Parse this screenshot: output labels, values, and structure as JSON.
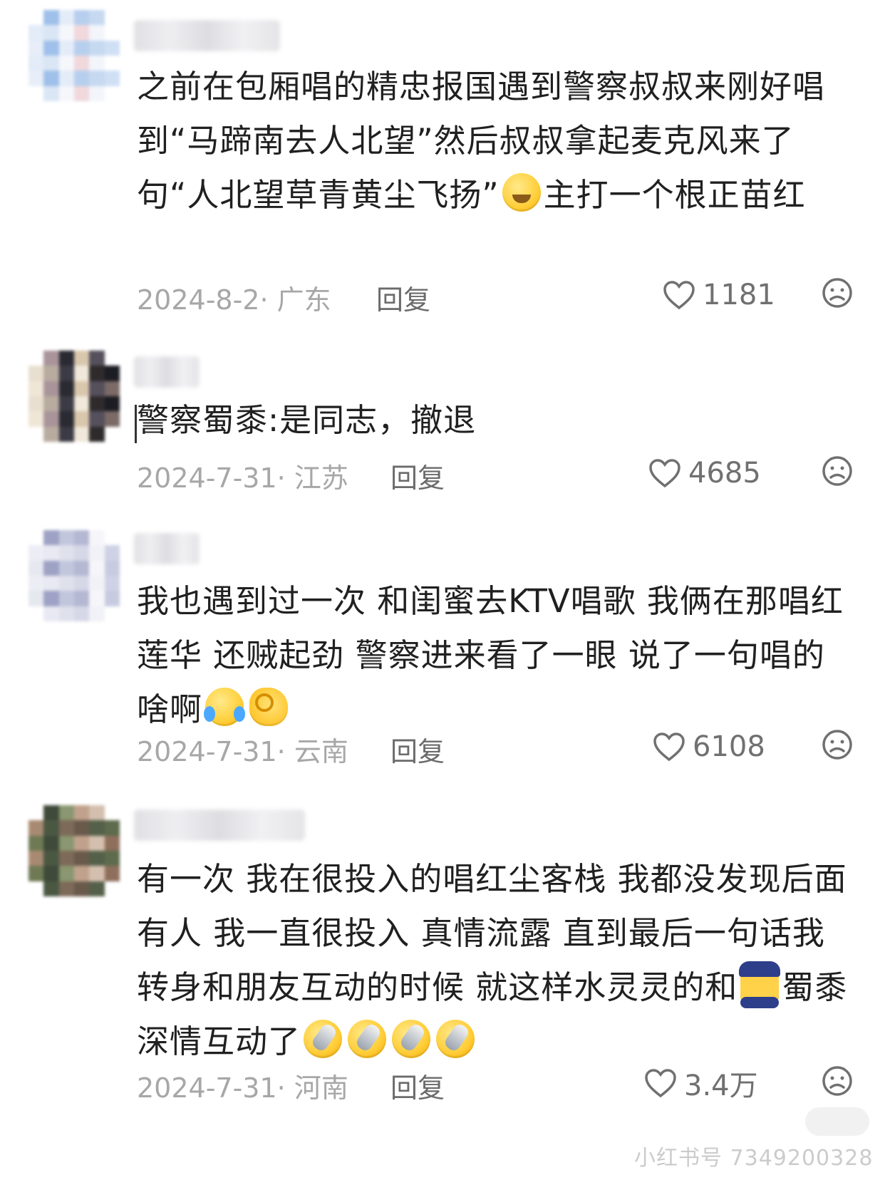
{
  "comments": [
    {
      "avatar_colors": [
        "#e8eef8",
        "#cfe0f5",
        "#f3f5fb",
        "#b7cfee",
        "#f6f7fb",
        "#9fc0ea",
        "#e2ebf7",
        "#ffffff",
        "#c6d9f1",
        "#f0d8dd",
        "#e4ecf8",
        "#dbe6f5"
      ],
      "text_before_emoji": "之前在包厢唱的精忠报国遇到警察叔叔来刚好唱到“马蹄南去人北望”然后叔叔拿起麦克风来了句“人北望草青黄尘飞扬”",
      "emoji": "pleading-face-icon",
      "text_after_emoji": "主打一个根正苗红",
      "date": "2024-8-2· 广东",
      "reply_label": "回复",
      "likes": "1181"
    },
    {
      "avatar_colors": [
        "#efe6d6",
        "#7b6a66",
        "#2f2a2c",
        "#d9c7ad",
        "#3c3a44",
        "#a9949a",
        "#e8dfd0",
        "#1c1c24",
        "#55505c",
        "#f0e8da",
        "#2a2a32",
        "#b8aca0"
      ],
      "text": "警察蜀黍:是同志，撤退",
      "date": "2024-7-31· 江苏",
      "reply_label": "回复",
      "likes": "4685"
    },
    {
      "avatar_colors": [
        "#e6e8f0",
        "#c8cbe0",
        "#f1f2f7",
        "#b5b8d2",
        "#dfe1ec",
        "#9ea2c4",
        "#eceef5",
        "#cfd2e6",
        "#f6f6fa",
        "#d6d8e8",
        "#c2c6dd",
        "#e8e9f2"
      ],
      "text_before_emoji": "我也遇到过一次 和闺蜜去KTV唱歌 我俩在那唱红莲华 还贼起劲 警察进来看了一眼 说了一句唱的啥啊",
      "emojis": [
        "rolling-on-floor-laughing-icon",
        "ok-hand-icon"
      ],
      "date": "2024-7-31· 云南",
      "reply_label": "回复",
      "likes": "6108"
    },
    {
      "avatar_colors": [
        "#6f7a55",
        "#8e6f5c",
        "#55604a",
        "#c0a28c",
        "#7d6a58",
        "#3f4a3a",
        "#a88a72",
        "#5e6b4c",
        "#d4bfae",
        "#6a5a4c",
        "#8a9770",
        "#4a5842"
      ],
      "text_line1": "有一次 我在很投入的唱红尘客栈 我都没发现后面有人 我一直很投入 真情流露 直到最后一句话我转身和朋友互动的时候 就这样水灵灵的和",
      "emoji_police": "police-officer-icon",
      "text_line2": "蜀黍深情互动了",
      "emojis_end": [
        "face-with-mic-icon",
        "face-with-mic-icon",
        "face-with-mic-icon",
        "face-with-mic-icon"
      ],
      "date": "2024-7-31· 河南",
      "reply_label": "回复",
      "likes": "3.4万"
    }
  ],
  "watermark": "小红书号 7349200328"
}
